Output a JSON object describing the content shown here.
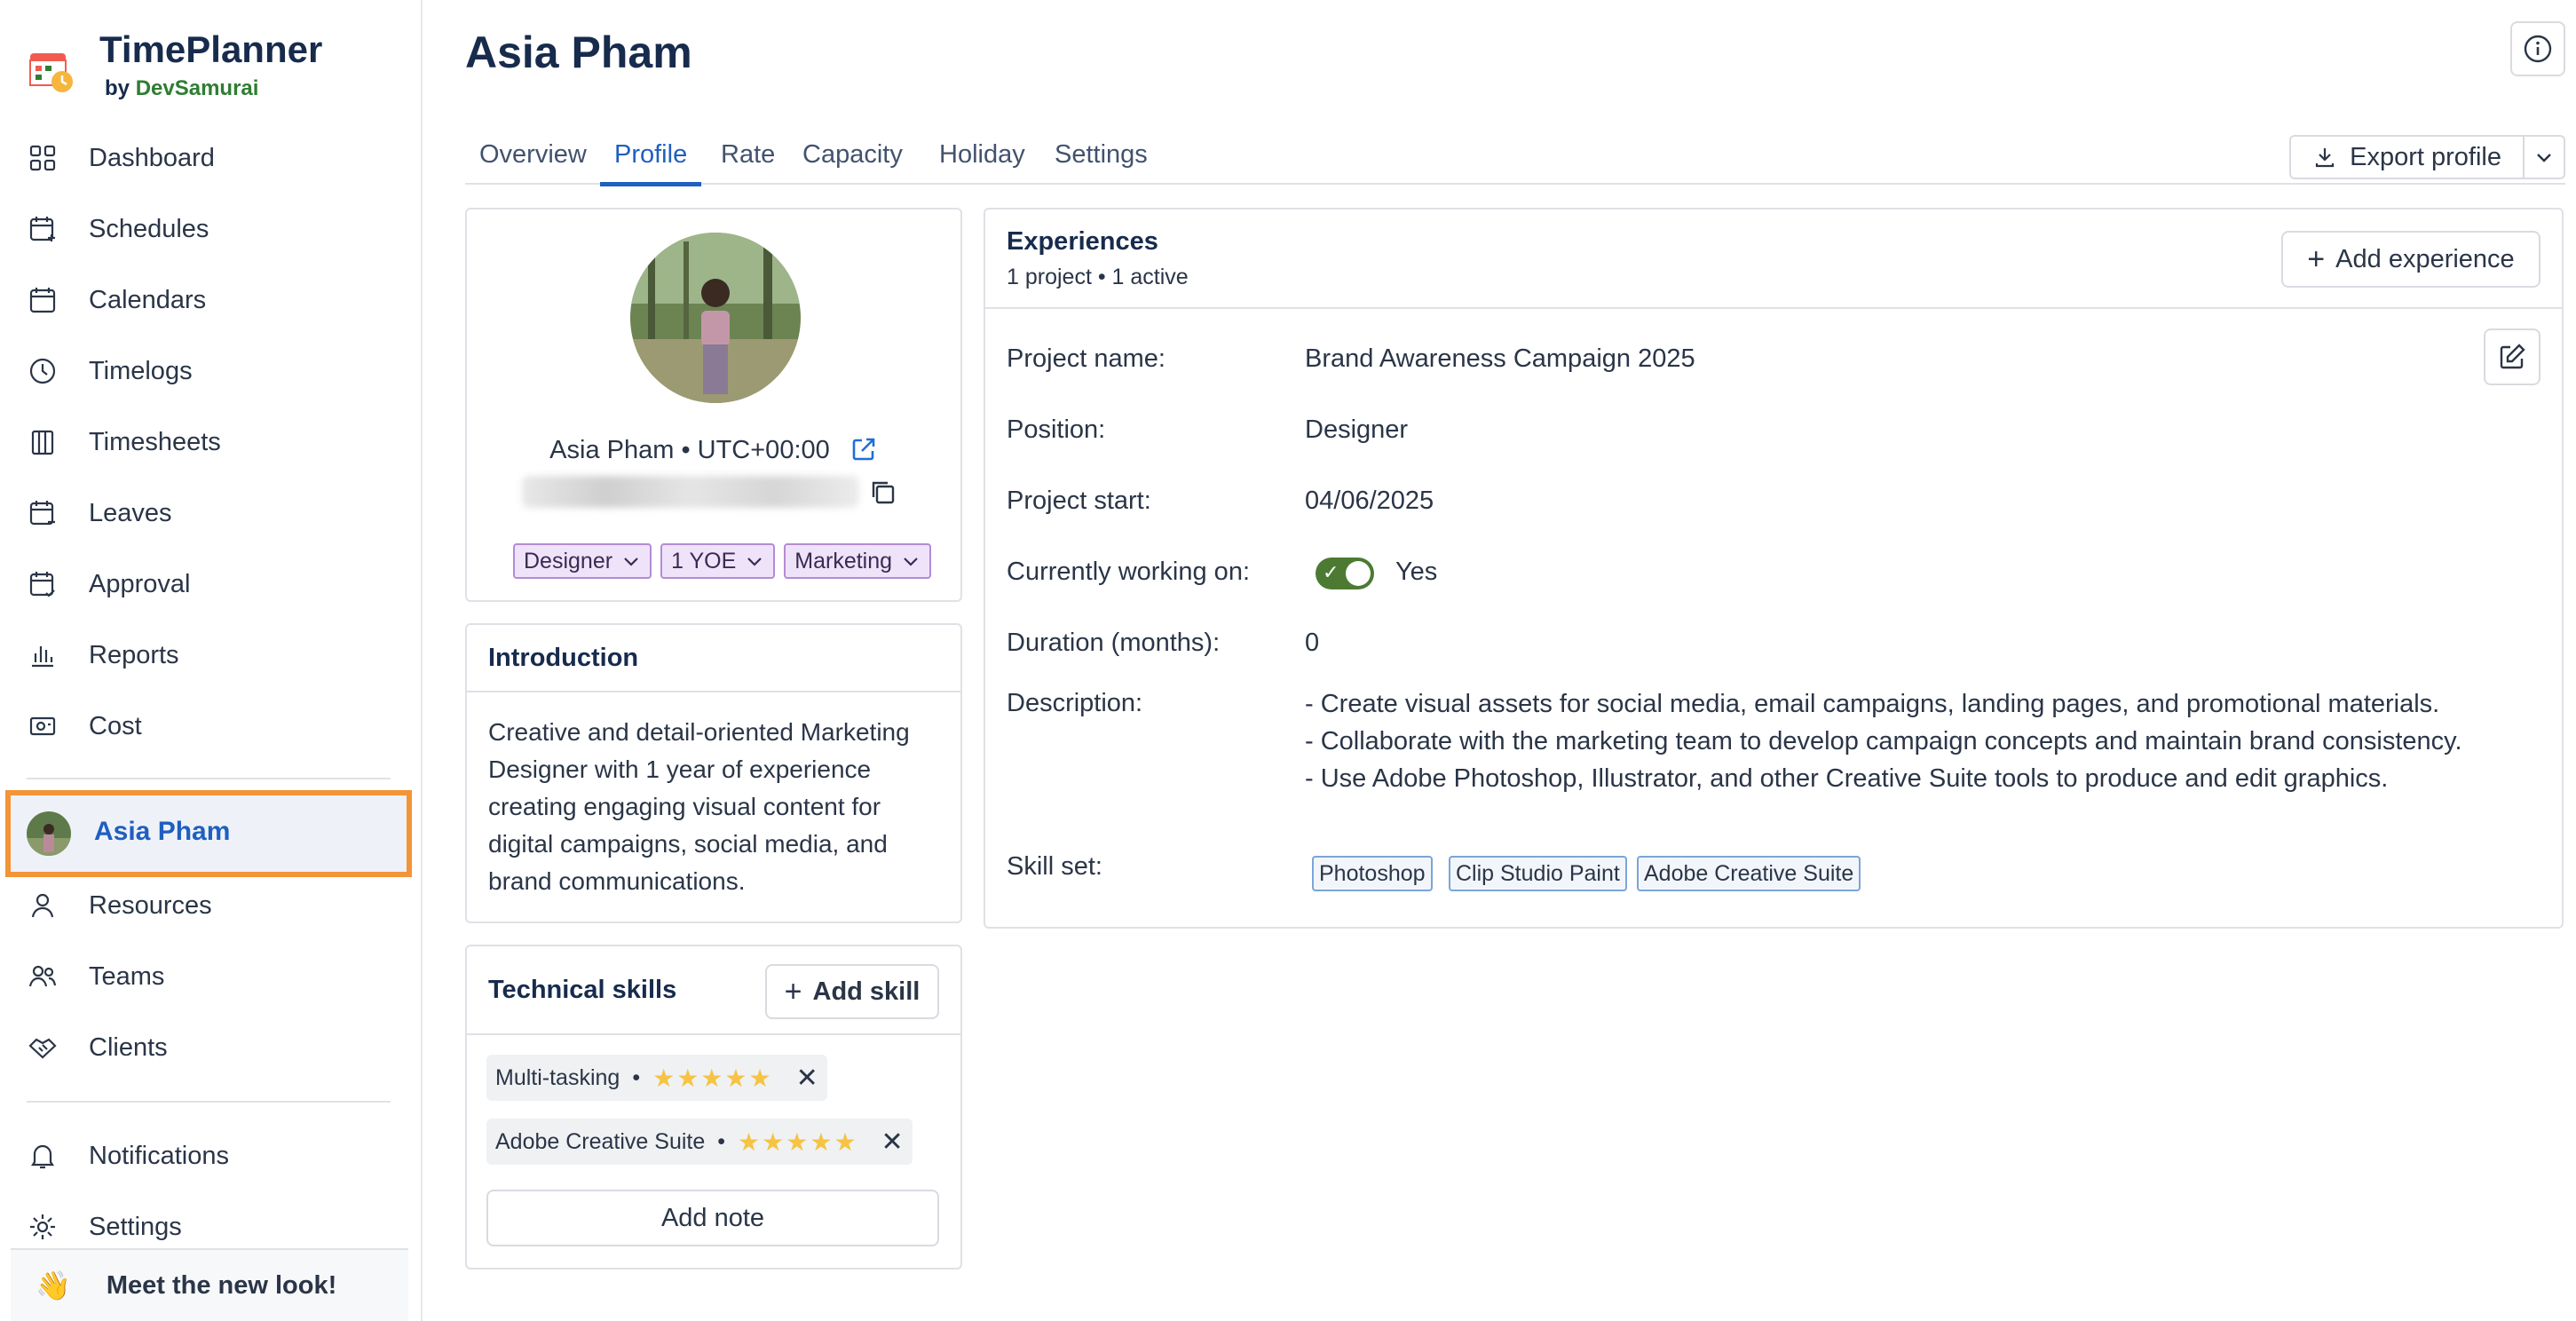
{
  "brand": {
    "name": "TimePlanner",
    "by": "by",
    "company": "DevSamurai"
  },
  "nav": {
    "items": [
      {
        "label": "Dashboard",
        "icon": "grid-icon"
      },
      {
        "label": "Schedules",
        "icon": "calendar-plus-icon"
      },
      {
        "label": "Calendars",
        "icon": "calendar-icon"
      },
      {
        "label": "Timelogs",
        "icon": "clock-icon"
      },
      {
        "label": "Timesheets",
        "icon": "columns-icon"
      },
      {
        "label": "Leaves",
        "icon": "calendar-minus-icon"
      },
      {
        "label": "Approval",
        "icon": "calendar-check-icon"
      },
      {
        "label": "Reports",
        "icon": "bar-chart-icon"
      },
      {
        "label": "Cost",
        "icon": "money-icon"
      }
    ],
    "active": "Asia Pham",
    "items2": [
      {
        "label": "Resources",
        "icon": "user-icon"
      },
      {
        "label": "Teams",
        "icon": "users-icon"
      },
      {
        "label": "Clients",
        "icon": "handshake-icon"
      }
    ],
    "items3": [
      {
        "label": "Notifications",
        "icon": "bell-icon"
      },
      {
        "label": "Settings",
        "icon": "gear-icon"
      }
    ],
    "meet": "Meet the new look!",
    "meet_emoji": "👋"
  },
  "page": {
    "title": "Asia Pham"
  },
  "tabs": [
    "Overview",
    "Profile",
    "Rate",
    "Capacity",
    "Holiday",
    "Settings"
  ],
  "active_tab": "Profile",
  "export": {
    "label": "Export profile"
  },
  "profile": {
    "name_tz": "Asia Pham • UTC+00:00",
    "tags": [
      "Designer",
      "1 YOE",
      "Marketing"
    ]
  },
  "intro": {
    "title": "Introduction",
    "text": "Creative and detail-oriented Marketing Designer with 1 year of experience creating engaging visual content for digital campaigns, social media, and brand communications."
  },
  "skills": {
    "title": "Technical skills",
    "add_label": "Add skill",
    "items": [
      {
        "name": "Multi-tasking",
        "stars": "★★★★★",
        "rating": 5
      },
      {
        "name": "Adobe Creative Suite",
        "stars": "★★★★★",
        "rating": 5
      }
    ],
    "dot": "•",
    "add_note": "Add note"
  },
  "experience": {
    "title": "Experiences",
    "subtitle": "1 project • 1 active",
    "add_label": "Add experience",
    "fields": {
      "project_name_label": "Project name:",
      "project_name": "Brand Awareness Campaign 2025",
      "position_label": "Position:",
      "position": "Designer",
      "start_label": "Project start:",
      "start": "04/06/2025",
      "working_label": "Currently working on:",
      "working": "Yes",
      "duration_label": "Duration (months):",
      "duration": "0",
      "description_label": "Description:",
      "description": [
        "- Create visual assets for social media, email campaigns, landing pages, and promotional materials.",
        "- Collaborate with the marketing team to develop campaign concepts and maintain brand consistency.",
        "- Use Adobe Photoshop, Illustrator, and other Creative Suite tools to produce and edit graphics."
      ],
      "skillset_label": "Skill set:",
      "skillset": [
        "Photoshop",
        "Clip Studio Paint",
        "Adobe Creative Suite"
      ]
    }
  },
  "colors": {
    "accent": "#1f5fbf",
    "highlight": "#f39437",
    "toggle": "#4c7a33",
    "tag_bg": "#efe3fa"
  }
}
